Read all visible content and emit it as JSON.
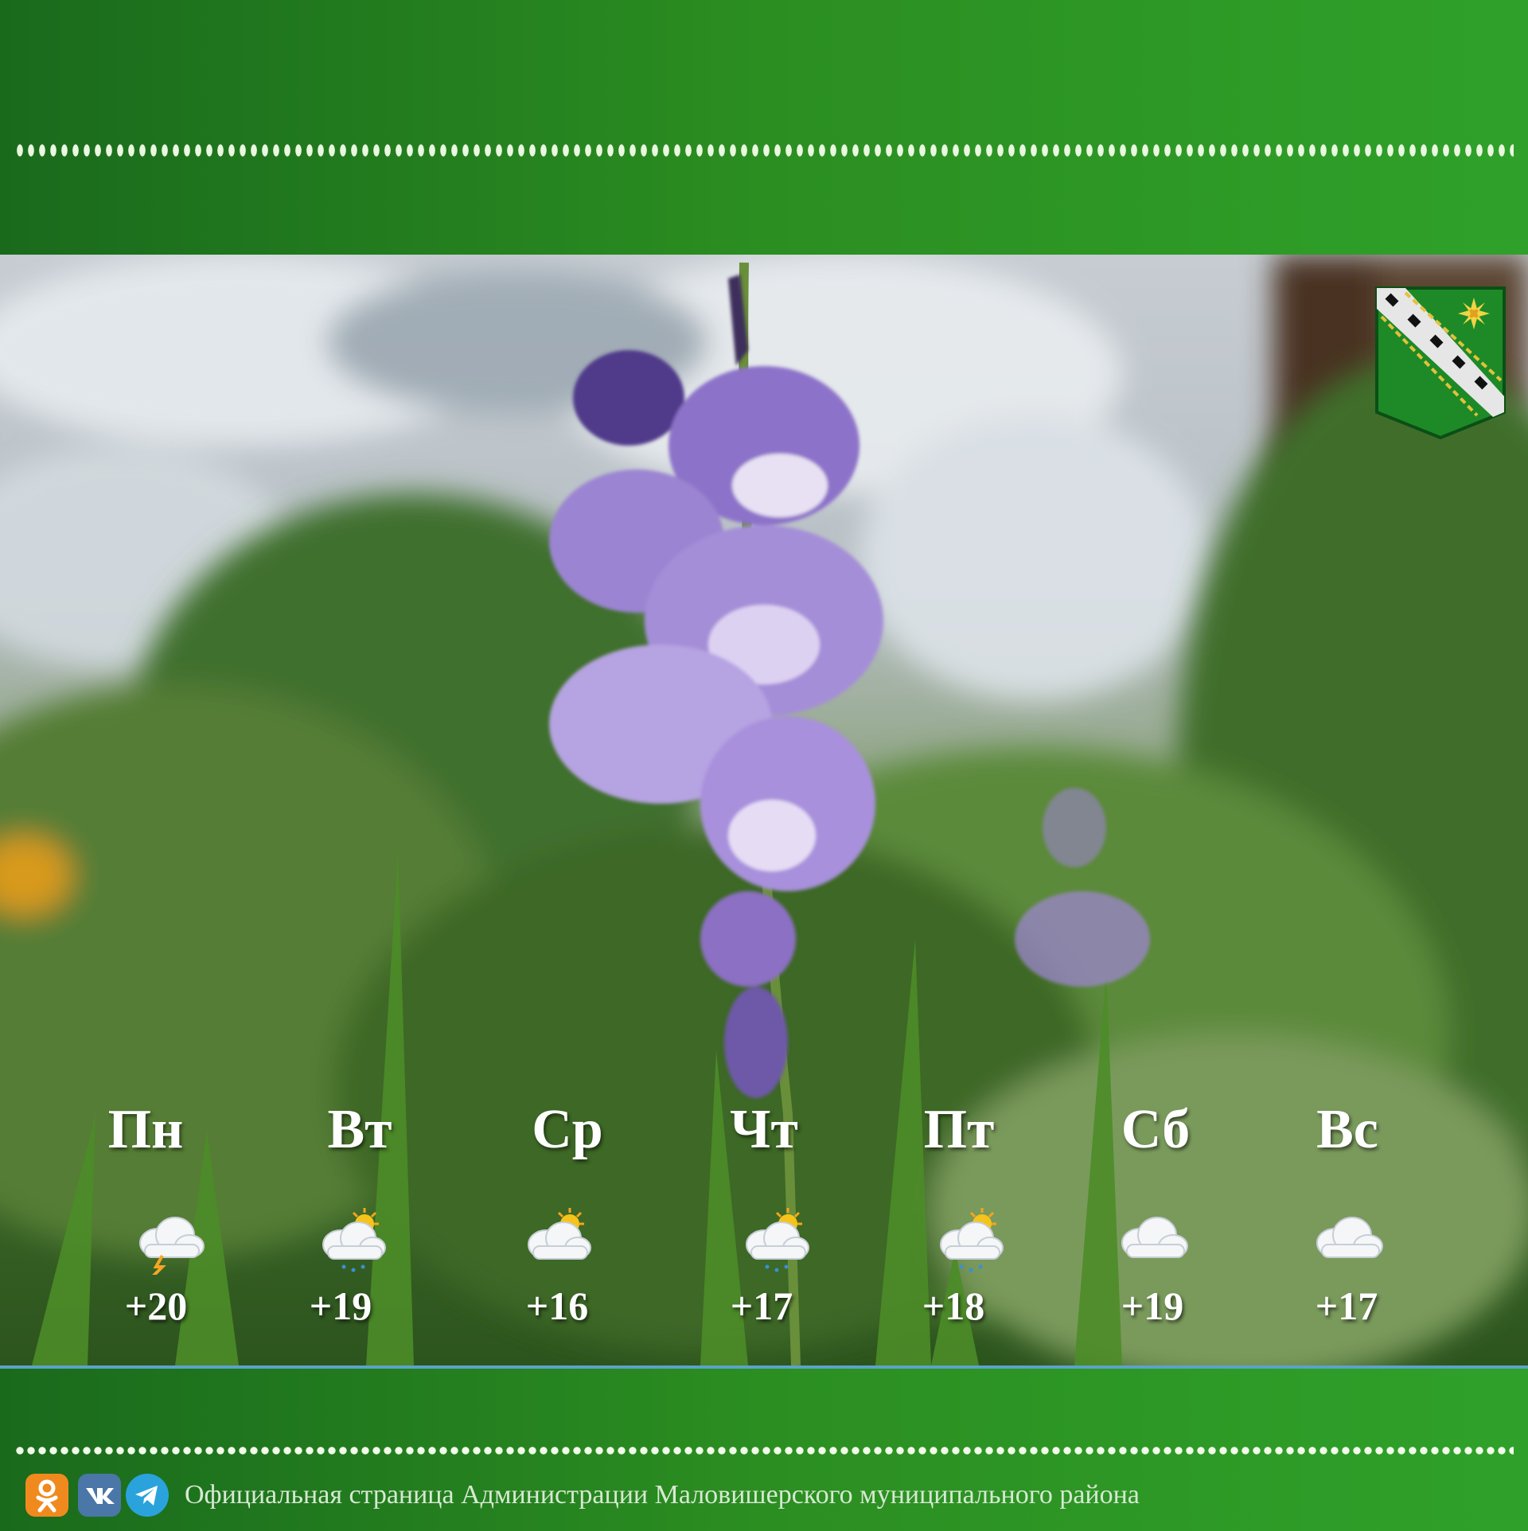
{
  "forecast": [
    {
      "day": "Пн",
      "temp": "+20",
      "icon": "cloud-lightning-icon"
    },
    {
      "day": "Вт",
      "temp": "+19",
      "icon": "sun-cloud-rain-icon"
    },
    {
      "day": "Ср",
      "temp": "+16",
      "icon": "sun-cloud-icon"
    },
    {
      "day": "Чт",
      "temp": "+17",
      "icon": "sun-cloud-rain-icon"
    },
    {
      "day": "Пт",
      "temp": "+18",
      "icon": "sun-cloud-rain-icon"
    },
    {
      "day": "Сб",
      "temp": "+19",
      "icon": "cloud-icon"
    },
    {
      "day": "Вс",
      "temp": "+17",
      "icon": "cloud-icon"
    }
  ],
  "footer": {
    "text": "Официальная страница Администрации Маловишерского муниципального района",
    "social": [
      "odnoklassniki-icon",
      "vk-icon",
      "telegram-icon"
    ]
  },
  "colors": {
    "band_green": "#2b8e21",
    "divider_blue": "#5aa3c8",
    "ok_orange": "#f08a1e",
    "vk_blue": "#4a76a8",
    "telegram_blue": "#2aa3dd"
  },
  "photo": {
    "subject": "lilac-gladiolus-flower"
  }
}
